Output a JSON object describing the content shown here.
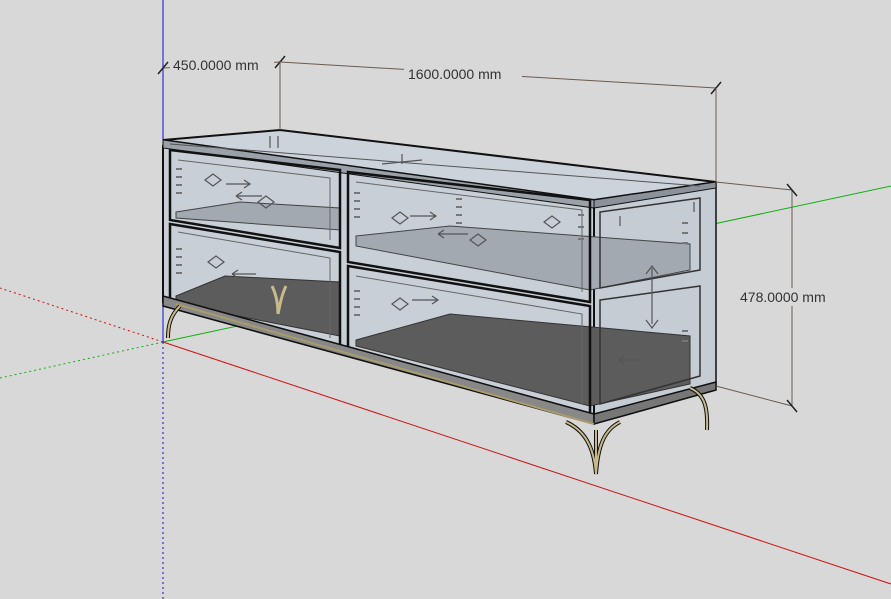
{
  "dimensions": {
    "depth_label": "450.0000 mm",
    "width_label": "1600.0000 mm",
    "height_label": "478.0000 mm"
  },
  "colors": {
    "background": "#d8d8d8",
    "axis_red": "#d01010",
    "axis_green": "#10b010",
    "axis_blue": "#1010d0",
    "glass_fill": "#c9cfd6",
    "drawer_floor": "#5c5c5c",
    "edge": "#111111",
    "leg_gold": "#c7b98a",
    "dimension_line": "#6b5b50"
  }
}
